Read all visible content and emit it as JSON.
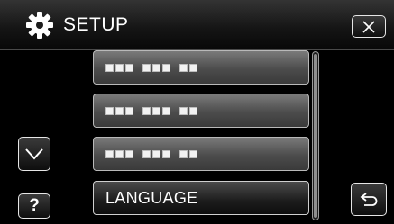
{
  "header": {
    "title": "SETUP",
    "icon": "gear-icon"
  },
  "menu": {
    "items": [
      {
        "label": "",
        "garbled": true
      },
      {
        "label": "",
        "garbled": true
      },
      {
        "label": "",
        "garbled": true
      },
      {
        "label": "LANGUAGE",
        "garbled": false
      }
    ]
  },
  "buttons": {
    "help_label": "?",
    "close_icon": "close-icon",
    "down_icon": "chevron-down-icon",
    "back_icon": "return-arrow-icon"
  },
  "colors": {
    "background": "#000000",
    "button_border": "#e6e6e6",
    "item_border": "#b9b9b9"
  }
}
